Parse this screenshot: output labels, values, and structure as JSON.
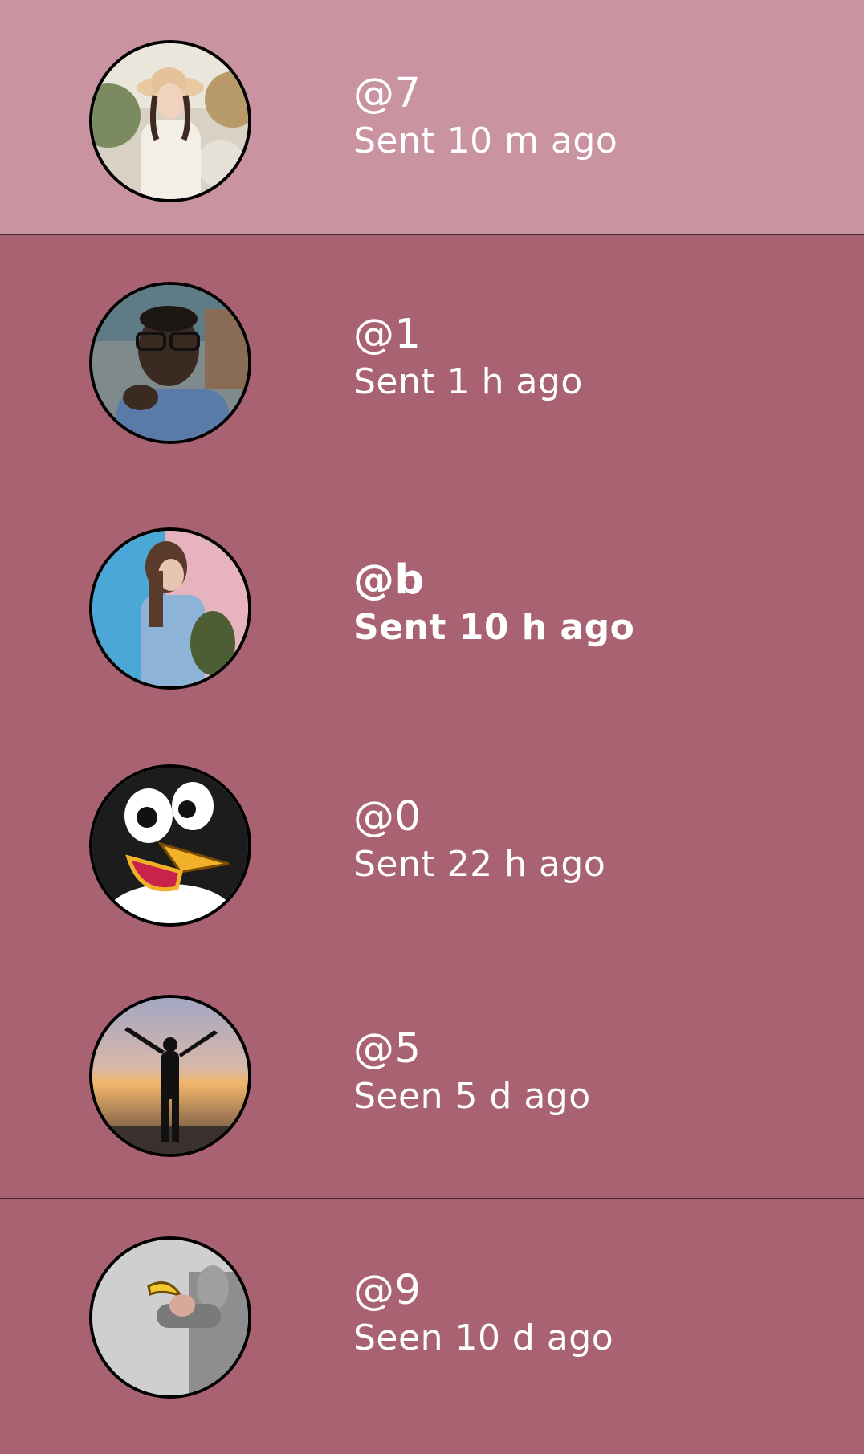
{
  "chats": [
    {
      "handle": "@7",
      "status": "Sent 10 m ago",
      "unread": false,
      "selected": true,
      "avatar": "avatar-woman-sun-hat"
    },
    {
      "handle": "@1",
      "status": "Sent 1 h ago",
      "unread": false,
      "selected": false,
      "avatar": "avatar-man-glasses"
    },
    {
      "handle": "@b",
      "status": "Sent 10 h ago",
      "unread": true,
      "selected": false,
      "avatar": "avatar-woman-denim-backpack"
    },
    {
      "handle": "@0",
      "status": "Sent 22 h ago",
      "unread": false,
      "selected": false,
      "avatar": "avatar-cartoon-penguin"
    },
    {
      "handle": "@5",
      "status": "Seen 5 d ago",
      "unread": false,
      "selected": false,
      "avatar": "avatar-silhouette-sunset"
    },
    {
      "handle": "@9",
      "status": "Seen 10 d ago",
      "unread": false,
      "selected": false,
      "avatar": "avatar-man-banana"
    }
  ],
  "colors": {
    "selected_row": "#c993a1",
    "row": "#a96272",
    "divider": "#3c2a2f",
    "text": "#ffffff"
  }
}
